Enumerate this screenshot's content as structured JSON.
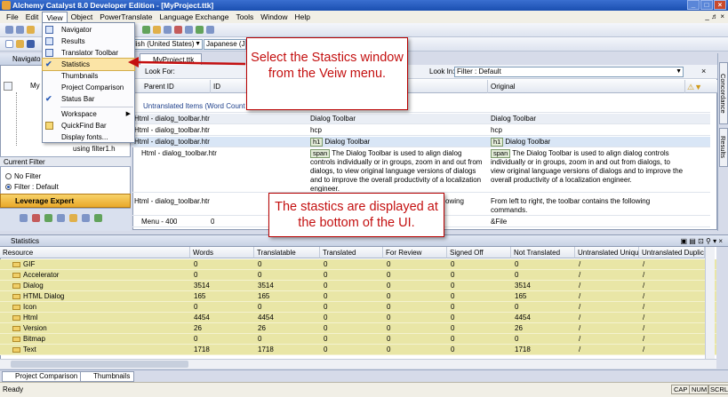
{
  "window": {
    "title": "Alchemy Catalyst 8.0 Developer Edition - [MyProject.ttk]",
    "controls": [
      "_",
      "□",
      "×"
    ]
  },
  "menubar": {
    "items": [
      "File",
      "Edit",
      "View",
      "Object",
      "PowerTranslate",
      "Language Exchange",
      "Tools",
      "Window",
      "Help"
    ],
    "mdi_controls": "_ ♬ ×"
  },
  "toolbar": {
    "source_lang": "lish (United States)",
    "target_lang": "Japanese (Japa"
  },
  "view_menu": {
    "items": [
      {
        "label": "Navigator",
        "icon": "navigator-icon"
      },
      {
        "label": "Results",
        "icon": "results-icon"
      },
      {
        "label": "Translator Toolbar",
        "icon": "toolbar-icon"
      },
      {
        "label": "Statistics",
        "icon": "check-icon"
      },
      {
        "label": "Thumbnails",
        "icon": "thumbnails-icon"
      },
      {
        "label": "Project Comparison",
        "icon": "compare-icon"
      },
      {
        "label": "Status Bar",
        "icon": "check-icon"
      },
      {
        "label": "Workspace",
        "icon": "workspace-icon"
      },
      {
        "label": "QuickFind Bar",
        "icon": "quickfind-icon"
      },
      {
        "label": "Display fonts...",
        "icon": "fonts-icon"
      }
    ]
  },
  "navigator": {
    "title": "Navigato",
    "tree_root": "My",
    "tree_child": "using filter1.h",
    "filter_title": "Current Filter",
    "filter_options": [
      "No Filter",
      "Filter : Default"
    ],
    "leverage_label": "Leverage Expert"
  },
  "document": {
    "tab": "MyProject.ttk",
    "look_for_label": "Look For:",
    "look_in_label": "Look In:",
    "look_in_value": "Filter : Default",
    "columns": [
      "Parent ID",
      "ID",
      "",
      "Original"
    ],
    "group_label": "Untranslated Items (Word Count : 1",
    "rows": [
      {
        "parent": "Html - dialog_toolbar.htr",
        "translation": "Dialog Toolbar",
        "original": "Dialog Toolbar"
      },
      {
        "parent": "Html - dialog_toolbar.htr",
        "translation": "hcp",
        "original": "hcp"
      },
      {
        "parent": "Html - dialog_toolbar.htr",
        "tag": "h1",
        "translation": "Dialog Toolbar",
        "original": "Dialog Toolbar"
      },
      {
        "parent": "Html - dialog_toolbar.htr",
        "tag": "span",
        "translation": "The Dialog Toolbar is used to align dialog controls individually or in groups, zoom in and out from dialogs, to view original language versions of dialogs and to improve the overall productivity of a localization engineer.",
        "original": "The Dialog Toolbar is used to align dialog controls individually or in groups, zoom in and out from dialogs, to view original language versions of dialogs and to improve the overall productivity of a localization engineer."
      },
      {
        "parent": "Html - dialog_toolbar.htr",
        "translation": "owing",
        "original": "From left to right, the toolbar contains the following commands."
      },
      {
        "parent": "Menu - 400",
        "id": "0",
        "translation": "",
        "original": "&File"
      }
    ]
  },
  "right_dock": {
    "tabs": [
      "Concordance",
      "Results"
    ]
  },
  "statistics": {
    "title": "Statistics",
    "columns": [
      "Resource",
      "Words",
      "Translatable",
      "Translated",
      "For Review",
      "Signed Off",
      "Not Translated",
      "Untranslated Uniques",
      "Untranslated Duplic..."
    ],
    "rows": [
      [
        "GIF",
        "0",
        "0",
        "0",
        "0",
        "0",
        "0",
        "/",
        "/"
      ],
      [
        "Accelerator",
        "0",
        "0",
        "0",
        "0",
        "0",
        "0",
        "/",
        "/"
      ],
      [
        "Dialog",
        "3514",
        "3514",
        "0",
        "0",
        "0",
        "3514",
        "/",
        "/"
      ],
      [
        "HTML Dialog",
        "165",
        "165",
        "0",
        "0",
        "0",
        "165",
        "/",
        "/"
      ],
      [
        "Icon",
        "0",
        "0",
        "0",
        "0",
        "0",
        "0",
        "/",
        "/"
      ],
      [
        "Html",
        "4454",
        "4454",
        "0",
        "0",
        "0",
        "4454",
        "/",
        "/"
      ],
      [
        "Version",
        "26",
        "26",
        "0",
        "0",
        "0",
        "26",
        "/",
        "/"
      ],
      [
        "Bitmap",
        "0",
        "0",
        "0",
        "0",
        "0",
        "0",
        "/",
        "/"
      ],
      [
        "Text",
        "1718",
        "1718",
        "0",
        "0",
        "0",
        "1718",
        "/",
        "/"
      ]
    ]
  },
  "bottom_tabs": [
    "Project Comparison",
    "Thumbnails"
  ],
  "statusbar": {
    "text": "Ready",
    "indicators": [
      "CAP",
      "NUM",
      "SCRL"
    ]
  },
  "callouts": {
    "top": "Select the Stastics window from the Veiw menu.",
    "bottom": "The stastics are displayed at the bottom of the UI."
  },
  "colors": {
    "callout_text": "#c41010",
    "stats_row": "#e9e6a6",
    "menu_highlight": "#fbe4a6"
  }
}
